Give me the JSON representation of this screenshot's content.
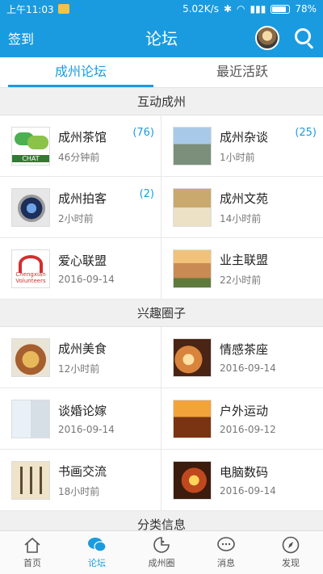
{
  "status_bar": {
    "time": "上午11:03",
    "speed": "5.02K/s",
    "battery": "78%"
  },
  "nav": {
    "left_label": "签到",
    "title": "论坛"
  },
  "tabs": [
    {
      "label": "成州论坛"
    },
    {
      "label": "最近活跃"
    }
  ],
  "sections": [
    {
      "title": "互动成州",
      "items": [
        {
          "name": "成州茶馆",
          "sub": "46分钟前",
          "count": "(76)",
          "thumb": "chat-icon",
          "thumb_text": "CHAT"
        },
        {
          "name": "成州杂谈",
          "sub": "1小时前",
          "count": "(25)",
          "thumb": "city-image"
        },
        {
          "name": "成州拍客",
          "sub": "2小时前",
          "count": "(2)",
          "thumb": "camera-lens-icon"
        },
        {
          "name": "成州文苑",
          "sub": "14小时前",
          "count": "",
          "thumb": "books-image"
        },
        {
          "name": "爱心联盟",
          "sub": "2016-09-14",
          "count": "",
          "thumb": "volunteer-logo",
          "thumb_text": "Chengxian Volunteers"
        },
        {
          "name": "业主联盟",
          "sub": "22小时前",
          "count": "",
          "thumb": "buildings-image"
        }
      ]
    },
    {
      "title": "兴趣圈子",
      "items": [
        {
          "name": "成州美食",
          "sub": "12小时前",
          "count": "",
          "thumb": "food-image"
        },
        {
          "name": "情感茶座",
          "sub": "2016-09-14",
          "count": "",
          "thumb": "heart-image"
        },
        {
          "name": "谈婚论嫁",
          "sub": "2016-09-14",
          "count": "",
          "thumb": "wedding-image"
        },
        {
          "name": "户外运动",
          "sub": "2016-09-12",
          "count": "",
          "thumb": "outdoor-image"
        },
        {
          "name": "书画交流",
          "sub": "18小时前",
          "count": "",
          "thumb": "calligraphy-image"
        },
        {
          "name": "电脑数码",
          "sub": "2016-09-14",
          "count": "",
          "thumb": "digital-image"
        }
      ]
    },
    {
      "title": "分类信息",
      "items": []
    }
  ],
  "bottom_nav": [
    {
      "label": "首页",
      "icon": "home-icon"
    },
    {
      "label": "论坛",
      "icon": "forum-icon"
    },
    {
      "label": "成州圈",
      "icon": "circle-icon"
    },
    {
      "label": "消息",
      "icon": "message-icon"
    },
    {
      "label": "发现",
      "icon": "compass-icon"
    }
  ],
  "colors": {
    "accent": "#1a9be0"
  }
}
